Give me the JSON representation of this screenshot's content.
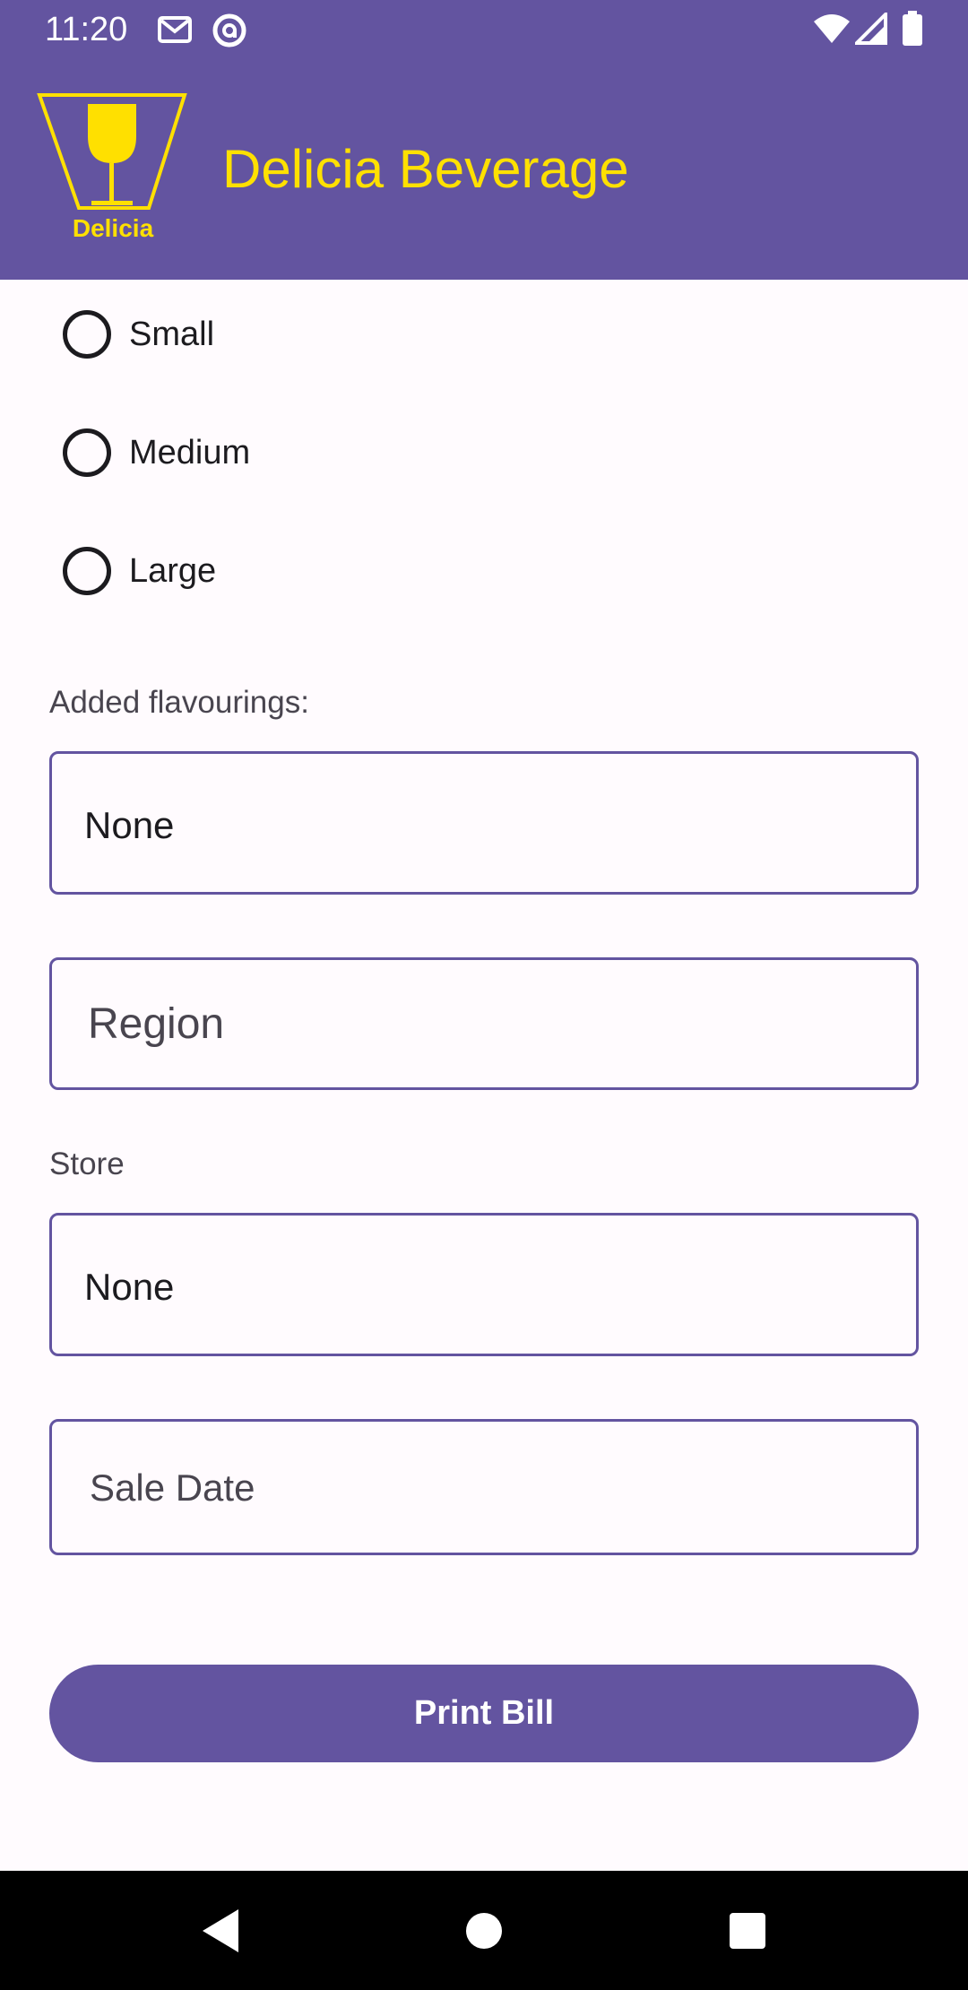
{
  "status_bar": {
    "time": "11:20"
  },
  "app_bar": {
    "title": "Delicia Beverage",
    "logo_text": "Delicia"
  },
  "size_options": [
    {
      "label": "Small"
    },
    {
      "label": "Medium"
    },
    {
      "label": "Large"
    }
  ],
  "flavourings": {
    "label": "Added flavourings:",
    "selected": "None"
  },
  "region": {
    "placeholder": "Region"
  },
  "store": {
    "label": "Store",
    "selected": "None"
  },
  "sale_date": {
    "placeholder": "Sale Date"
  },
  "actions": {
    "print_label": "Print Bill"
  },
  "colors": {
    "primary": "#6354A0",
    "accent": "#FFE000",
    "background": "#FFFBFE"
  }
}
